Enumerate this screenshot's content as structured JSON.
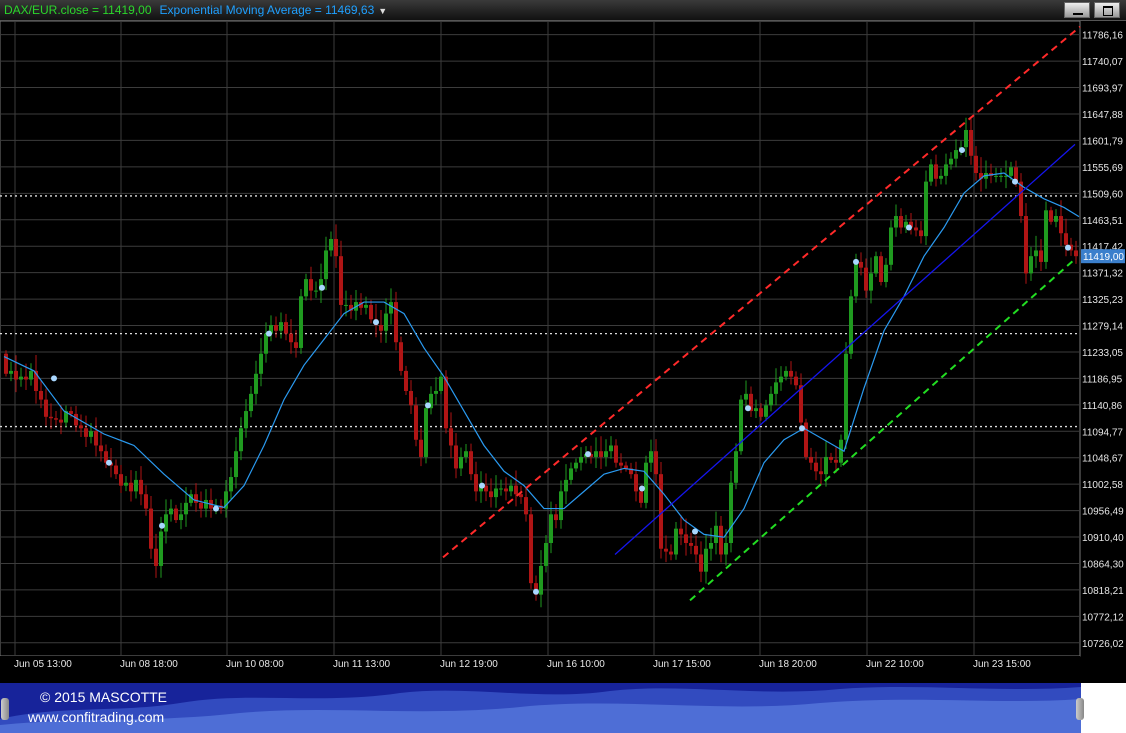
{
  "legend": {
    "series_label": "DAX/EUR.close = 11419,00",
    "ema_label": "Exponential Moving Average = 11469,63",
    "dropdown_icon": "triangle-down-icon"
  },
  "window_buttons": {
    "minimize_icon": "minimize-icon",
    "restore_icon": "restore-icon"
  },
  "footer": {
    "copyright": "© 2015 MASCOTTE",
    "website": "www.confitrading.com"
  },
  "colors": {
    "background": "#000000",
    "grid": "#3c3c3c",
    "bull_candle": "#1f9a1f",
    "bear_candle": "#b01515",
    "ema_line": "#2a9af0",
    "marker": "#a9d7ff",
    "upper_channel": "#ff2a2a",
    "lower_channel": "#22dd22",
    "mid_channel": "#1515ee",
    "price_tag_bg": "#3b7fcc",
    "footer_bg": "#17239a"
  },
  "chart_data": {
    "type": "candlestick",
    "instrument": "DAX/EUR",
    "ylim": [
      10703,
      11810
    ],
    "yticks": [
      "11786,16",
      "11740,07",
      "11693,97",
      "11647,88",
      "11601,79",
      "11555,69",
      "11509,60",
      "11463,51",
      "11417,42",
      "11371,32",
      "11325,23",
      "11279,14",
      "11233,05",
      "11186,95",
      "11140,86",
      "11094,77",
      "11048,67",
      "11002,58",
      "10956,49",
      "10910,40",
      "10864,30",
      "10818,21",
      "10772,12",
      "10726,02"
    ],
    "yvalues": [
      11786.16,
      11740.07,
      11693.97,
      11647.88,
      11601.79,
      11555.69,
      11509.6,
      11463.51,
      11417.42,
      11371.32,
      11325.23,
      11279.14,
      11233.05,
      11186.95,
      11140.86,
      11094.77,
      11048.67,
      11002.58,
      10956.49,
      10910.4,
      10864.3,
      10818.21,
      10772.12,
      10726.02
    ],
    "xticks": [
      "Jun 05 13:00",
      "Jun 08 18:00",
      "Jun 10 08:00",
      "Jun 11 13:00",
      "Jun 12 19:00",
      "Jun 16 10:00",
      "Jun 17 15:00",
      "Jun 18 20:00",
      "Jun 22 10:00",
      "Jun 23 15:00"
    ],
    "last_price_label": "11419,00",
    "last_price": 11400,
    "horizontal_levels": [
      11505,
      11265,
      11103
    ],
    "price_path": [
      [
        0,
        11230
      ],
      [
        5,
        11195
      ],
      [
        10,
        11200
      ],
      [
        15,
        11185
      ],
      [
        20,
        11190
      ],
      [
        25,
        11185
      ],
      [
        30,
        11200
      ],
      [
        35,
        11165
      ],
      [
        40,
        11150
      ],
      [
        45,
        11120
      ],
      [
        55,
        11115
      ],
      [
        60,
        11110
      ],
      [
        65,
        11130
      ],
      [
        70,
        11125
      ],
      [
        75,
        11105
      ],
      [
        80,
        11100
      ],
      [
        85,
        11085
      ],
      [
        90,
        11095
      ],
      [
        95,
        11070
      ],
      [
        100,
        11060
      ],
      [
        105,
        11040
      ],
      [
        110,
        11035
      ],
      [
        115,
        11020
      ],
      [
        120,
        11000
      ],
      [
        125,
        11005
      ],
      [
        130,
        10990
      ],
      [
        135,
        11010
      ],
      [
        140,
        10985
      ],
      [
        145,
        10960
      ],
      [
        150,
        10890
      ],
      [
        155,
        10860
      ],
      [
        160,
        10920
      ],
      [
        165,
        10950
      ],
      [
        170,
        10960
      ],
      [
        175,
        10940
      ],
      [
        180,
        10950
      ],
      [
        185,
        10970
      ],
      [
        190,
        10985
      ],
      [
        195,
        10970
      ],
      [
        200,
        10960
      ],
      [
        205,
        10975
      ],
      [
        210,
        10960
      ],
      [
        215,
        10965
      ],
      [
        220,
        10960
      ],
      [
        225,
        10990
      ],
      [
        230,
        11015
      ],
      [
        235,
        11060
      ],
      [
        240,
        11100
      ],
      [
        245,
        11130
      ],
      [
        250,
        11160
      ],
      [
        255,
        11195
      ],
      [
        260,
        11230
      ],
      [
        265,
        11265
      ],
      [
        270,
        11280
      ],
      [
        275,
        11270
      ],
      [
        280,
        11285
      ],
      [
        285,
        11265
      ],
      [
        290,
        11250
      ],
      [
        295,
        11240
      ],
      [
        300,
        11330
      ],
      [
        305,
        11360
      ],
      [
        310,
        11340
      ],
      [
        315,
        11340
      ],
      [
        320,
        11360
      ],
      [
        325,
        11410
      ],
      [
        330,
        11430
      ],
      [
        335,
        11400
      ],
      [
        340,
        11315
      ],
      [
        345,
        11315
      ],
      [
        350,
        11305
      ],
      [
        355,
        11320
      ],
      [
        360,
        11310
      ],
      [
        365,
        11315
      ],
      [
        370,
        11290
      ],
      [
        375,
        11280
      ],
      [
        380,
        11270
      ],
      [
        385,
        11300
      ],
      [
        390,
        11320
      ],
      [
        395,
        11250
      ],
      [
        400,
        11200
      ],
      [
        405,
        11165
      ],
      [
        410,
        11140
      ],
      [
        415,
        11080
      ],
      [
        420,
        11050
      ],
      [
        425,
        11135
      ],
      [
        430,
        11160
      ],
      [
        435,
        11165
      ],
      [
        440,
        11190
      ],
      [
        445,
        11100
      ],
      [
        450,
        11070
      ],
      [
        455,
        11030
      ],
      [
        460,
        11050
      ],
      [
        465,
        11060
      ],
      [
        470,
        11020
      ],
      [
        475,
        10990
      ],
      [
        480,
        11000
      ],
      [
        485,
        10990
      ],
      [
        490,
        10980
      ],
      [
        495,
        10995
      ],
      [
        500,
        10995
      ],
      [
        505,
        10990
      ],
      [
        510,
        11000
      ],
      [
        515,
        10985
      ],
      [
        520,
        10980
      ],
      [
        525,
        10950
      ],
      [
        530,
        10830
      ],
      [
        535,
        10810
      ],
      [
        540,
        10860
      ],
      [
        545,
        10900
      ],
      [
        550,
        10950
      ],
      [
        555,
        10940
      ],
      [
        560,
        10990
      ],
      [
        565,
        11010
      ],
      [
        570,
        11030
      ],
      [
        575,
        11040
      ],
      [
        580,
        11050
      ],
      [
        585,
        11055
      ],
      [
        590,
        11050
      ],
      [
        595,
        11060
      ],
      [
        600,
        11050
      ],
      [
        605,
        11060
      ],
      [
        610,
        11070
      ],
      [
        615,
        11040
      ],
      [
        620,
        11035
      ],
      [
        625,
        11030
      ],
      [
        630,
        11020
      ],
      [
        635,
        10990
      ],
      [
        640,
        10970
      ],
      [
        645,
        11040
      ],
      [
        650,
        11060
      ],
      [
        655,
        11020
      ],
      [
        660,
        10890
      ],
      [
        665,
        10885
      ],
      [
        670,
        10880
      ],
      [
        675,
        10925
      ],
      [
        680,
        10915
      ],
      [
        685,
        10900
      ],
      [
        690,
        10895
      ],
      [
        695,
        10880
      ],
      [
        700,
        10850
      ],
      [
        705,
        10890
      ],
      [
        710,
        10900
      ],
      [
        715,
        10930
      ],
      [
        720,
        10880
      ],
      [
        725,
        10900
      ],
      [
        730,
        11005
      ],
      [
        735,
        11060
      ],
      [
        740,
        11150
      ],
      [
        745,
        11160
      ],
      [
        750,
        11130
      ],
      [
        755,
        11135
      ],
      [
        760,
        11120
      ],
      [
        765,
        11140
      ],
      [
        770,
        11160
      ],
      [
        775,
        11180
      ],
      [
        780,
        11190
      ],
      [
        785,
        11200
      ],
      [
        790,
        11190
      ],
      [
        795,
        11175
      ],
      [
        800,
        11110
      ],
      [
        805,
        11050
      ],
      [
        810,
        11040
      ],
      [
        815,
        11025
      ],
      [
        820,
        11020
      ],
      [
        825,
        11050
      ],
      [
        830,
        11045
      ],
      [
        835,
        11040
      ],
      [
        840,
        11080
      ],
      [
        845,
        11230
      ],
      [
        850,
        11330
      ],
      [
        855,
        11390
      ],
      [
        860,
        11380
      ],
      [
        865,
        11340
      ],
      [
        870,
        11370
      ],
      [
        875,
        11400
      ],
      [
        880,
        11355
      ],
      [
        885,
        11385
      ],
      [
        890,
        11450
      ],
      [
        895,
        11470
      ],
      [
        900,
        11450
      ],
      [
        905,
        11460
      ],
      [
        910,
        11450
      ],
      [
        915,
        11445
      ],
      [
        920,
        11435
      ],
      [
        925,
        11530
      ],
      [
        930,
        11560
      ],
      [
        935,
        11535
      ],
      [
        940,
        11540
      ],
      [
        945,
        11560
      ],
      [
        950,
        11570
      ],
      [
        955,
        11585
      ],
      [
        960,
        11590
      ],
      [
        965,
        11620
      ],
      [
        970,
        11575
      ],
      [
        975,
        11545
      ],
      [
        980,
        11535
      ],
      [
        985,
        11545
      ],
      [
        990,
        11540
      ],
      [
        995,
        11540
      ],
      [
        1000,
        11540
      ],
      [
        1005,
        11540
      ],
      [
        1010,
        11555
      ],
      [
        1015,
        11530
      ],
      [
        1020,
        11470
      ],
      [
        1025,
        11370
      ],
      [
        1030,
        11400
      ],
      [
        1035,
        11410
      ],
      [
        1040,
        11390
      ],
      [
        1045,
        11480
      ],
      [
        1050,
        11460
      ],
      [
        1055,
        11470
      ],
      [
        1060,
        11440
      ],
      [
        1065,
        11420
      ],
      [
        1070,
        11410
      ],
      [
        1075,
        11400
      ]
    ],
    "ema_path": [
      [
        0,
        11225
      ],
      [
        30,
        11200
      ],
      [
        60,
        11130
      ],
      [
        100,
        11090
      ],
      [
        130,
        11070
      ],
      [
        160,
        11020
      ],
      [
        190,
        10975
      ],
      [
        220,
        10962
      ],
      [
        240,
        11000
      ],
      [
        260,
        11070
      ],
      [
        280,
        11150
      ],
      [
        300,
        11210
      ],
      [
        320,
        11255
      ],
      [
        340,
        11300
      ],
      [
        360,
        11320
      ],
      [
        380,
        11320
      ],
      [
        400,
        11300
      ],
      [
        420,
        11240
      ],
      [
        440,
        11190
      ],
      [
        460,
        11130
      ],
      [
        480,
        11070
      ],
      [
        500,
        11025
      ],
      [
        520,
        11000
      ],
      [
        540,
        10960
      ],
      [
        560,
        10960
      ],
      [
        580,
        10990
      ],
      [
        600,
        11020
      ],
      [
        620,
        11030
      ],
      [
        640,
        11025
      ],
      [
        660,
        10985
      ],
      [
        680,
        10940
      ],
      [
        700,
        10915
      ],
      [
        720,
        10910
      ],
      [
        740,
        10960
      ],
      [
        760,
        11040
      ],
      [
        780,
        11080
      ],
      [
        800,
        11100
      ],
      [
        820,
        11080
      ],
      [
        840,
        11060
      ],
      [
        860,
        11170
      ],
      [
        880,
        11270
      ],
      [
        900,
        11330
      ],
      [
        920,
        11400
      ],
      [
        940,
        11450
      ],
      [
        960,
        11510
      ],
      [
        980,
        11540
      ],
      [
        1000,
        11545
      ],
      [
        1020,
        11520
      ],
      [
        1040,
        11500
      ],
      [
        1060,
        11485
      ],
      [
        1075,
        11469
      ]
    ],
    "channels": {
      "upper": {
        "from": [
          443,
          10875
        ],
        "to": [
          1080,
          11800
        ]
      },
      "middle": {
        "from": [
          615,
          10880
        ],
        "to": [
          1075,
          11595
        ]
      },
      "lower": {
        "from": [
          690,
          10800
        ],
        "to": [
          1075,
          11395
        ]
      }
    },
    "markers": [
      [
        50,
        11187
      ],
      [
        105,
        11040
      ],
      [
        158,
        10930
      ],
      [
        212,
        10960
      ],
      [
        265,
        11265
      ],
      [
        318,
        11345
      ],
      [
        372,
        11285
      ],
      [
        424,
        11140
      ],
      [
        478,
        11000
      ],
      [
        532,
        10815
      ],
      [
        584,
        11055
      ],
      [
        638,
        10995
      ],
      [
        691,
        10920
      ],
      [
        744,
        11135
      ],
      [
        798,
        11100
      ],
      [
        852,
        11390
      ],
      [
        905,
        11450
      ],
      [
        958,
        11585
      ],
      [
        1011,
        11530
      ],
      [
        1064,
        11415
      ]
    ]
  }
}
